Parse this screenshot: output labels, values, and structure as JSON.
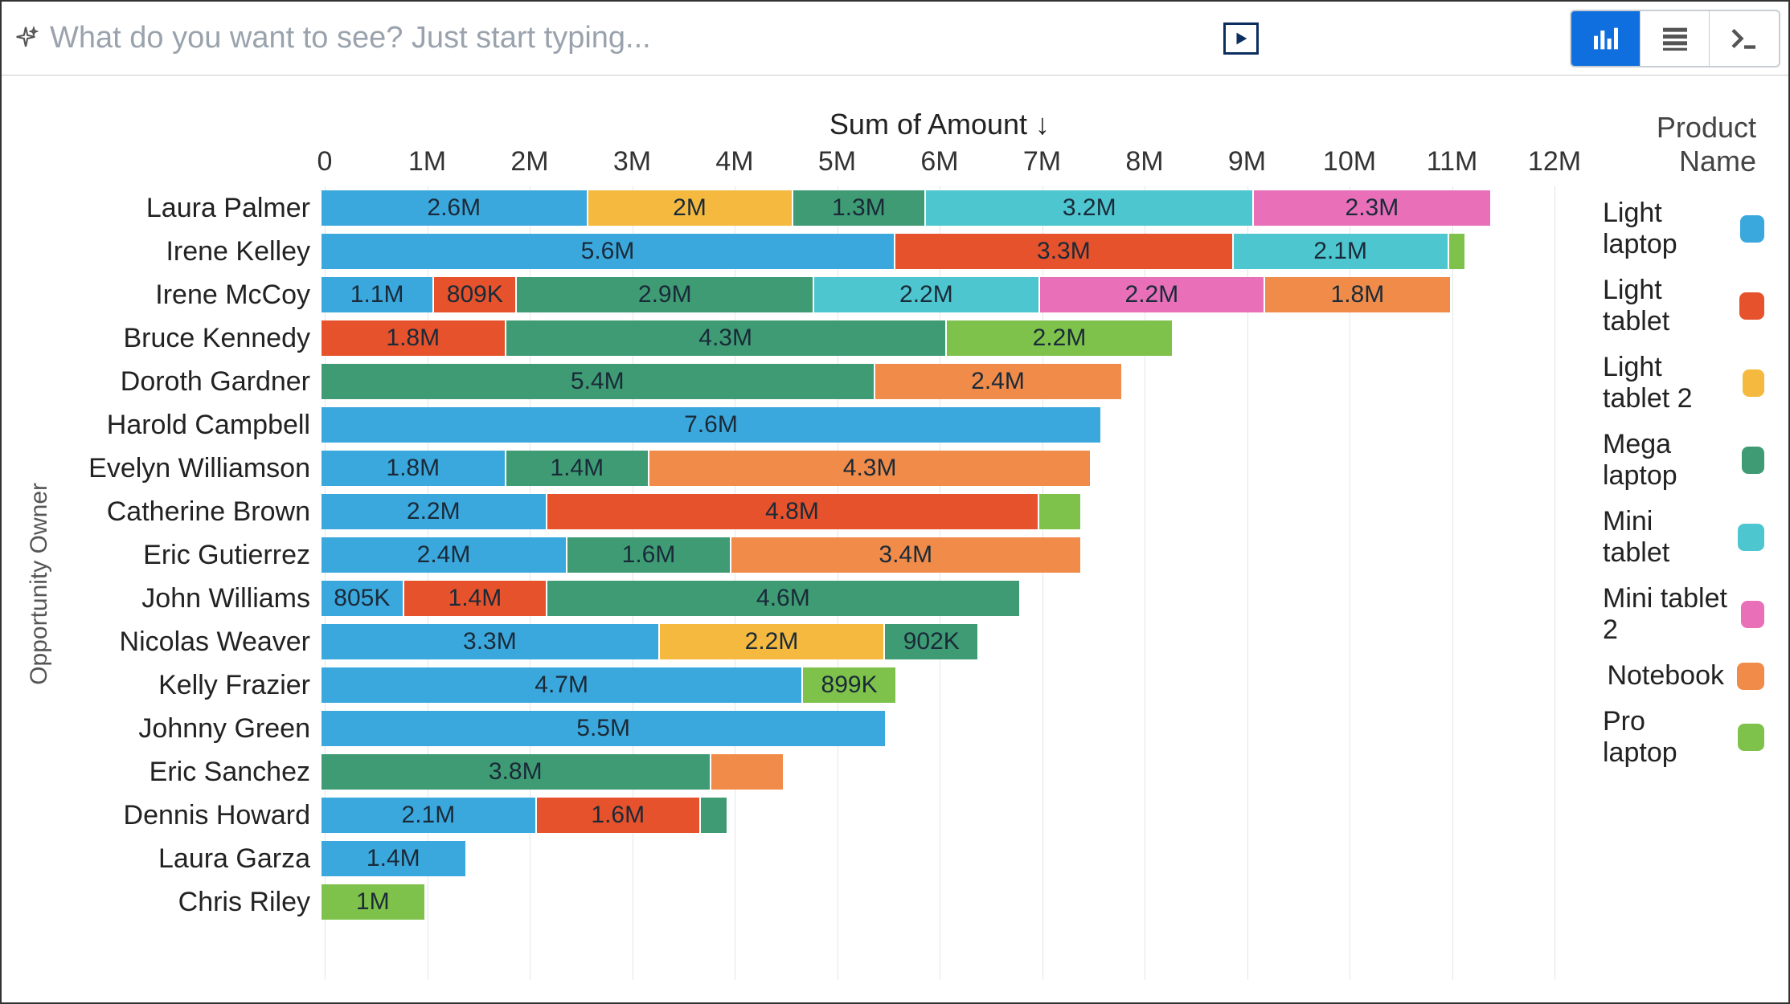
{
  "search": {
    "placeholder": "What do you want to see? Just start typing..."
  },
  "toolbar": {
    "view_chart": "chart",
    "view_table": "table",
    "view_console": "console"
  },
  "chart": {
    "x_title": "Sum of Amount ↓",
    "y_title": "Opportunity Owner",
    "legend_title": "Product Name",
    "x_max": 12000000,
    "ticks": [
      "0",
      "1M",
      "2M",
      "3M",
      "4M",
      "5M",
      "6M",
      "7M",
      "8M",
      "9M",
      "10M",
      "11M",
      "12M"
    ]
  },
  "colors": {
    "Light laptop": "#3ba8dd",
    "Light tablet": "#e6522c",
    "Light tablet 2": "#f5b93f",
    "Mega laptop": "#3e9b74",
    "Mini tablet": "#4ec6cf",
    "Mini tablet 2": "#e86fb8",
    "Notebook": "#f08b4a",
    "Pro laptop": "#7fc24b"
  },
  "legend_order": [
    "Light laptop",
    "Light tablet",
    "Light tablet 2",
    "Mega laptop",
    "Mini tablet",
    "Mini tablet 2",
    "Notebook",
    "Pro laptop"
  ],
  "chart_data": {
    "type": "bar",
    "orientation": "horizontal",
    "stacked": true,
    "xlabel": "Sum of Amount",
    "ylabel": "Opportunity Owner",
    "xlim": [
      0,
      12000000
    ],
    "categories": [
      "Laura Palmer",
      "Irene Kelley",
      "Irene McCoy",
      "Bruce Kennedy",
      "Doroth Gardner",
      "Harold Campbell",
      "Evelyn Williamson",
      "Catherine Brown",
      "Eric Gutierrez",
      "John Williams",
      "Nicolas Weaver",
      "Kelly Frazier",
      "Johnny Green",
      "Eric Sanchez",
      "Dennis Howard",
      "Laura Garza",
      "Chris Riley"
    ],
    "rows": [
      {
        "owner": "Laura Palmer",
        "segments": [
          {
            "product": "Light laptop",
            "value": 2600000,
            "label": "2.6M"
          },
          {
            "product": "Light tablet 2",
            "value": 2000000,
            "label": "2M"
          },
          {
            "product": "Mega laptop",
            "value": 1300000,
            "label": "1.3M"
          },
          {
            "product": "Mini tablet",
            "value": 3200000,
            "label": "3.2M"
          },
          {
            "product": "Mini tablet 2",
            "value": 2300000,
            "label": "2.3M"
          }
        ]
      },
      {
        "owner": "Irene Kelley",
        "segments": [
          {
            "product": "Light laptop",
            "value": 5600000,
            "label": "5.6M"
          },
          {
            "product": "Light tablet",
            "value": 3300000,
            "label": "3.3M"
          },
          {
            "product": "Mini tablet",
            "value": 2100000,
            "label": "2.1M"
          },
          {
            "product": "Pro laptop",
            "value": 150000,
            "label": ""
          }
        ]
      },
      {
        "owner": "Irene McCoy",
        "segments": [
          {
            "product": "Light laptop",
            "value": 1100000,
            "label": "1.1M"
          },
          {
            "product": "Light tablet",
            "value": 809000,
            "label": "809K"
          },
          {
            "product": "Mega laptop",
            "value": 2900000,
            "label": "2.9M"
          },
          {
            "product": "Mini tablet",
            "value": 2200000,
            "label": "2.2M"
          },
          {
            "product": "Mini tablet 2",
            "value": 2200000,
            "label": "2.2M"
          },
          {
            "product": "Notebook",
            "value": 1800000,
            "label": "1.8M"
          }
        ]
      },
      {
        "owner": "Bruce Kennedy",
        "segments": [
          {
            "product": "Light tablet",
            "value": 1800000,
            "label": "1.8M"
          },
          {
            "product": "Mega laptop",
            "value": 4300000,
            "label": "4.3M"
          },
          {
            "product": "Pro laptop",
            "value": 2200000,
            "label": "2.2M"
          }
        ]
      },
      {
        "owner": "Doroth Gardner",
        "segments": [
          {
            "product": "Mega laptop",
            "value": 5400000,
            "label": "5.4M"
          },
          {
            "product": "Notebook",
            "value": 2400000,
            "label": "2.4M"
          }
        ]
      },
      {
        "owner": "Harold Campbell",
        "segments": [
          {
            "product": "Light laptop",
            "value": 7600000,
            "label": "7.6M"
          }
        ]
      },
      {
        "owner": "Evelyn Williamson",
        "segments": [
          {
            "product": "Light laptop",
            "value": 1800000,
            "label": "1.8M"
          },
          {
            "product": "Mega laptop",
            "value": 1400000,
            "label": "1.4M"
          },
          {
            "product": "Notebook",
            "value": 4300000,
            "label": "4.3M"
          }
        ]
      },
      {
        "owner": "Catherine Brown",
        "segments": [
          {
            "product": "Light laptop",
            "value": 2200000,
            "label": "2.2M"
          },
          {
            "product": "Light tablet",
            "value": 4800000,
            "label": "4.8M"
          },
          {
            "product": "Pro laptop",
            "value": 400000,
            "label": ""
          }
        ]
      },
      {
        "owner": "Eric Gutierrez",
        "segments": [
          {
            "product": "Light laptop",
            "value": 2400000,
            "label": "2.4M"
          },
          {
            "product": "Mega laptop",
            "value": 1600000,
            "label": "1.6M"
          },
          {
            "product": "Notebook",
            "value": 3400000,
            "label": "3.4M"
          }
        ]
      },
      {
        "owner": "John Williams",
        "segments": [
          {
            "product": "Light laptop",
            "value": 805000,
            "label": "805K"
          },
          {
            "product": "Light tablet",
            "value": 1400000,
            "label": "1.4M"
          },
          {
            "product": "Mega laptop",
            "value": 4600000,
            "label": "4.6M"
          }
        ]
      },
      {
        "owner": "Nicolas Weaver",
        "segments": [
          {
            "product": "Light laptop",
            "value": 3300000,
            "label": "3.3M"
          },
          {
            "product": "Light tablet 2",
            "value": 2200000,
            "label": "2.2M"
          },
          {
            "product": "Mega laptop",
            "value": 902000,
            "label": "902K"
          }
        ]
      },
      {
        "owner": "Kelly Frazier",
        "segments": [
          {
            "product": "Light laptop",
            "value": 4700000,
            "label": "4.7M"
          },
          {
            "product": "Pro laptop",
            "value": 899000,
            "label": "899K"
          }
        ]
      },
      {
        "owner": "Johnny Green",
        "segments": [
          {
            "product": "Light laptop",
            "value": 5500000,
            "label": "5.5M"
          }
        ]
      },
      {
        "owner": "Eric Sanchez",
        "segments": [
          {
            "product": "Mega laptop",
            "value": 3800000,
            "label": "3.8M"
          },
          {
            "product": "Notebook",
            "value": 700000,
            "label": ""
          }
        ]
      },
      {
        "owner": "Dennis Howard",
        "segments": [
          {
            "product": "Light laptop",
            "value": 2100000,
            "label": "2.1M"
          },
          {
            "product": "Light tablet",
            "value": 1600000,
            "label": "1.6M"
          },
          {
            "product": "Mega laptop",
            "value": 250000,
            "label": ""
          }
        ]
      },
      {
        "owner": "Laura Garza",
        "segments": [
          {
            "product": "Light laptop",
            "value": 1400000,
            "label": "1.4M"
          }
        ]
      },
      {
        "owner": "Chris Riley",
        "segments": [
          {
            "product": "Pro laptop",
            "value": 1000000,
            "label": "1M"
          }
        ]
      }
    ]
  }
}
